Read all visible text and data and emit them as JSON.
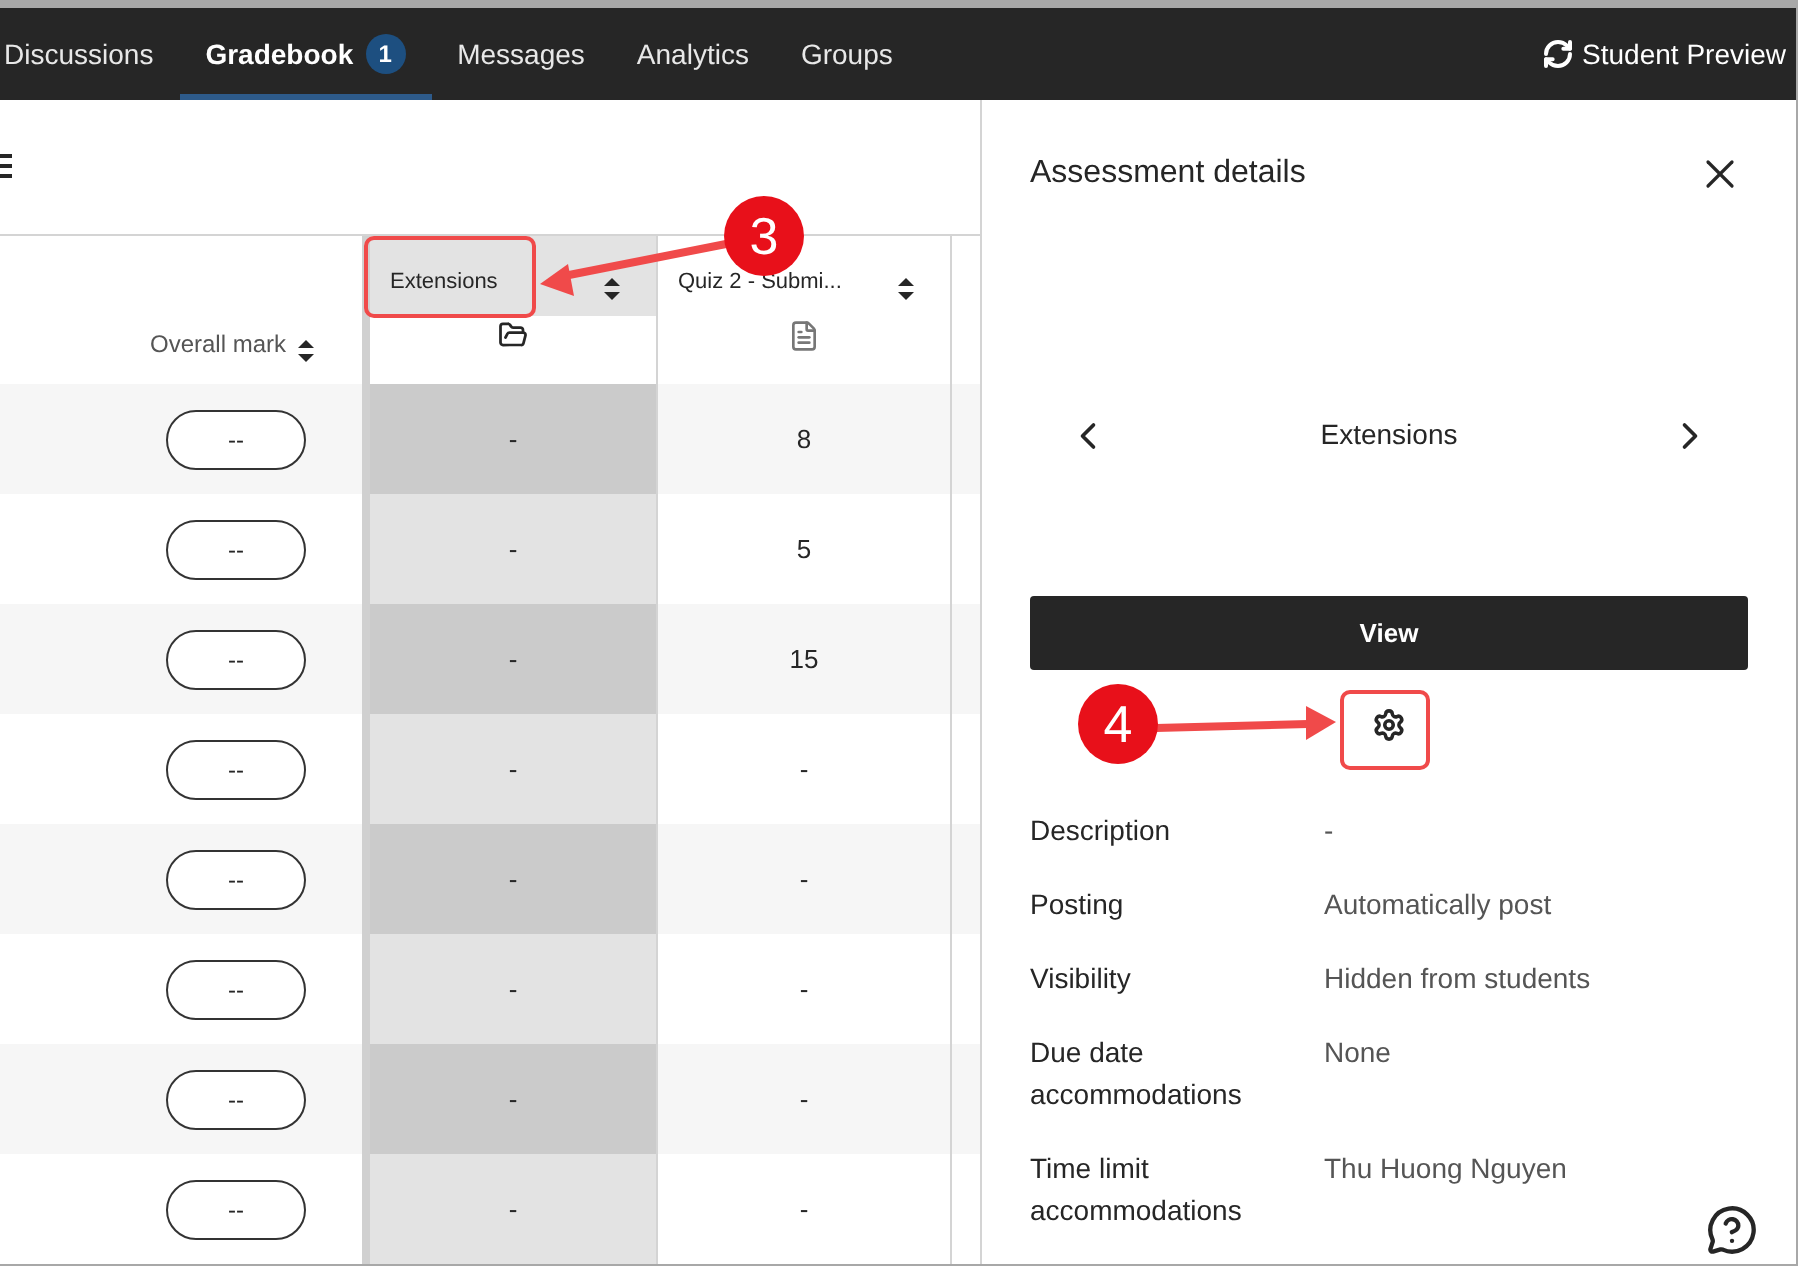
{
  "nav": {
    "tabs": [
      {
        "label": "Discussions",
        "selected": false
      },
      {
        "label": "Gradebook",
        "selected": true,
        "badge": "1"
      },
      {
        "label": "Messages",
        "selected": false
      },
      {
        "label": "Analytics",
        "selected": false
      },
      {
        "label": "Groups",
        "selected": false
      }
    ],
    "student_preview": "Student Preview"
  },
  "table": {
    "overall_mark_header": "Overall mark",
    "columns": [
      {
        "label": "Extensions",
        "kind": "folder",
        "selected": true
      },
      {
        "label": "Quiz 2 - Submi...",
        "kind": "assignment",
        "selected": false
      }
    ],
    "rows": [
      {
        "overall_mark": "--",
        "cells": [
          "-",
          "8"
        ]
      },
      {
        "overall_mark": "--",
        "cells": [
          "-",
          "5"
        ]
      },
      {
        "overall_mark": "--",
        "cells": [
          "-",
          "15"
        ]
      },
      {
        "overall_mark": "--",
        "cells": [
          "-",
          "-"
        ]
      },
      {
        "overall_mark": "--",
        "cells": [
          "-",
          "-"
        ]
      },
      {
        "overall_mark": "--",
        "cells": [
          "-",
          "-"
        ]
      },
      {
        "overall_mark": "--",
        "cells": [
          "-",
          "-"
        ]
      },
      {
        "overall_mark": "--",
        "cells": [
          "-",
          "-"
        ]
      }
    ]
  },
  "panel": {
    "title": "Assessment details",
    "item_title": "Extensions",
    "view_button": "View",
    "details": [
      {
        "label": "Description",
        "value": "-"
      },
      {
        "label": "Posting",
        "value": "Automatically post"
      },
      {
        "label": "Visibility",
        "value": "Hidden from students"
      },
      {
        "label": "Due date accommodations",
        "value": "None"
      },
      {
        "label": "Time limit accommodations",
        "value": "Thu Huong Nguyen"
      }
    ]
  },
  "callouts": [
    {
      "number": "3"
    },
    {
      "number": "4"
    }
  ]
}
